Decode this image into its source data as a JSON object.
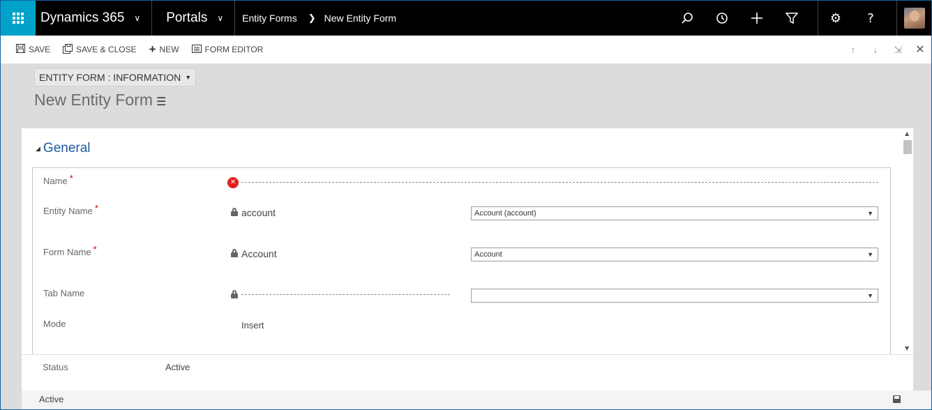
{
  "topnav": {
    "app_title": "Dynamics 365",
    "area": "Portals",
    "breadcrumb": [
      "Entity Forms",
      "New Entity Form"
    ],
    "icons": [
      "waffle-icon",
      "search-icon",
      "history-icon",
      "plus-icon",
      "filter-icon",
      "gear-icon",
      "help-icon",
      "avatar"
    ]
  },
  "toolbar": {
    "save_label": "SAVE",
    "save_close_label": "SAVE & CLOSE",
    "new_label": "NEW",
    "form_editor_label": "FORM EDITOR"
  },
  "header": {
    "form_selector": "ENTITY FORM : INFORMATION",
    "title": "New Entity Form"
  },
  "section": {
    "title": "General",
    "fields": {
      "name": {
        "label": "Name",
        "required": "*"
      },
      "entity_name": {
        "label": "Entity Name",
        "required": "*",
        "value": "account",
        "select": "Account (account)"
      },
      "form_name": {
        "label": "Form Name",
        "required": "*",
        "value": "Account",
        "select": "Account"
      },
      "tab_name": {
        "label": "Tab Name",
        "select": ""
      },
      "mode": {
        "label": "Mode",
        "value": "Insert"
      }
    }
  },
  "footer": {
    "status_label": "Status",
    "status_value": "Active",
    "statusbar_text": "Active"
  },
  "colors": {
    "topnav_bg": "#000000",
    "waffle_bg": "#00a2c9",
    "section_title": "#1e5aa5",
    "required": "#cc0000",
    "error": "#e21d1d"
  }
}
